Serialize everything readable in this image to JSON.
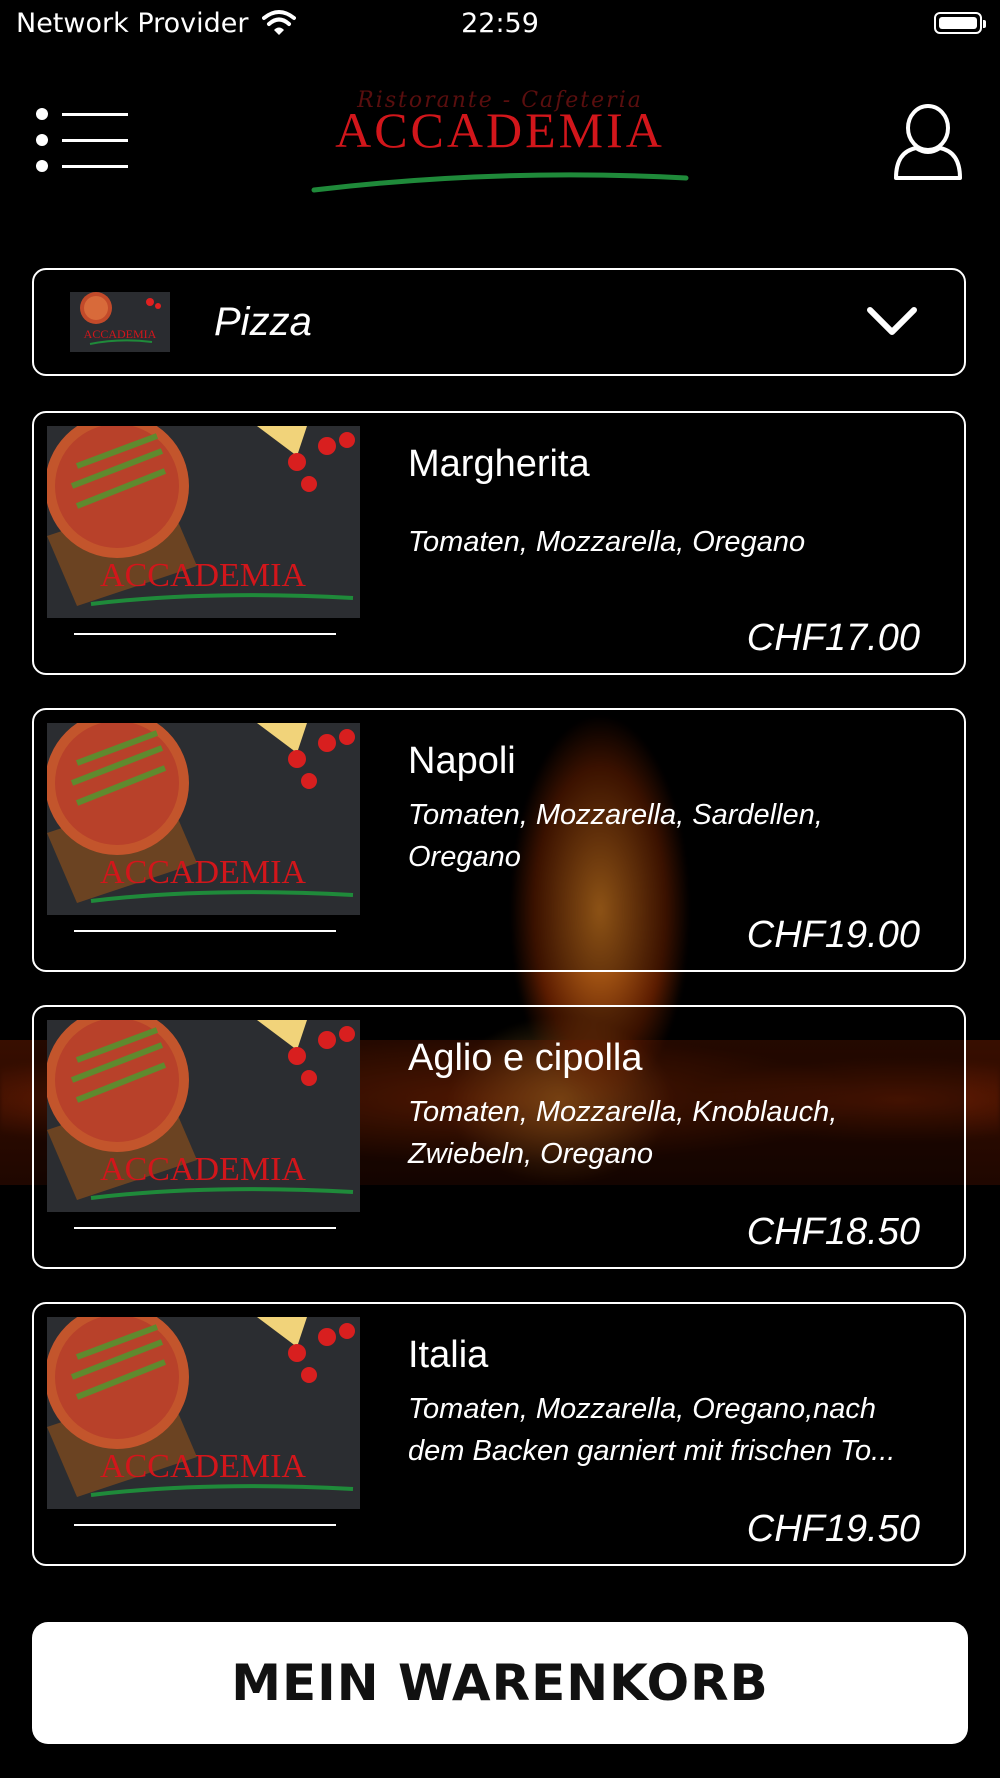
{
  "status_bar": {
    "provider": "Network Provider",
    "time": "22:59"
  },
  "header": {
    "logo_script": "Ristorante - Cafeteria",
    "logo_brand": "ACCADEMIA",
    "menu_icon": "hamburger-menu-icon",
    "profile_icon": "user-profile-icon"
  },
  "category": {
    "label": "Pizza",
    "icon": "chevron-down-icon"
  },
  "products": [
    {
      "name": "Margherita",
      "description": "Tomaten, Mozzarella, Oregano",
      "price": "CHF17.00"
    },
    {
      "name": "Napoli",
      "description": "Tomaten, Mozzarella, Sardellen, Oregano",
      "price": "CHF19.00"
    },
    {
      "name": "Aglio e cipolla",
      "description": "Tomaten, Mozzarella, Knoblauch, Zwiebeln, Oregano",
      "price": "CHF18.50"
    },
    {
      "name": "Italia",
      "description": "Tomaten, Mozzarella, Oregano,nach dem Backen garniert mit frischen To...",
      "price": "CHF19.50"
    }
  ],
  "cart": {
    "label": "MEIN WARENKORB"
  },
  "colors": {
    "background": "#000000",
    "accent_red": "#d2161b",
    "accent_green": "#1f8a3a"
  }
}
